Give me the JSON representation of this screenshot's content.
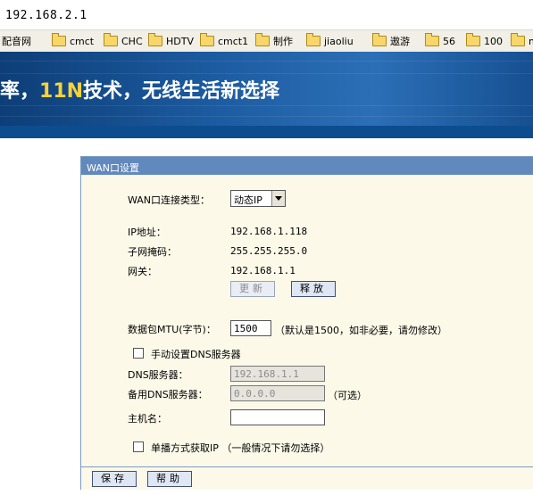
{
  "address_bar": {
    "url": "192.168.2.1"
  },
  "bookmarks": [
    {
      "label": "配音网",
      "icon": "folder-icon"
    },
    {
      "label": "cmct",
      "icon": "folder-icon"
    },
    {
      "label": "CHC",
      "icon": "folder-icon"
    },
    {
      "label": "HDTV",
      "icon": "folder-icon"
    },
    {
      "label": "cmct1",
      "icon": "folder-icon"
    },
    {
      "label": "制作",
      "icon": "folder-icon"
    },
    {
      "label": "jiaoliu",
      "icon": "folder-icon"
    },
    {
      "label": "遨游",
      "icon": "folder-icon"
    },
    {
      "label": "56",
      "icon": "folder-icon"
    },
    {
      "label": "100",
      "icon": "folder-icon"
    },
    {
      "label": "m",
      "icon": "folder-icon"
    }
  ],
  "banner": {
    "slogan_pre": "率，",
    "slogan_highlight": "11N",
    "slogan_post": "技术，无线生活新选择"
  },
  "panel": {
    "title": "WAN口设置",
    "conn_type_label": "WAN口连接类型：",
    "conn_type_value": "动态IP",
    "ip_label": "IP地址：",
    "ip_value": "192.168.1.118",
    "mask_label": "子网掩码：",
    "mask_value": "255.255.255.0",
    "gateway_label": "网关：",
    "gateway_value": "192.168.1.1",
    "renew_button": "更新",
    "release_button": "释放",
    "mtu_label": "数据包MTU(字节)：",
    "mtu_value": "1500",
    "mtu_hint": "（默认是1500，如非必要，请勿修改）",
    "manual_dns_label": "手动设置DNS服务器",
    "dns_label": "DNS服务器：",
    "dns_value": "192.168.1.1",
    "alt_dns_label": "备用DNS服务器：",
    "alt_dns_value": "0.0.0.0",
    "optional_hint": "（可选）",
    "hostname_label": "主机名：",
    "hostname_value": "",
    "unicast_label": "单播方式获取IP （一般情况下请勿选择）",
    "save_button": "保存",
    "help_button": "帮助"
  },
  "colors": {
    "banner": "#1c5ba0",
    "panel_header": "#6289bd",
    "panel_bg": "#fdf9e9",
    "slogan_highlight": "#f6d33b"
  }
}
